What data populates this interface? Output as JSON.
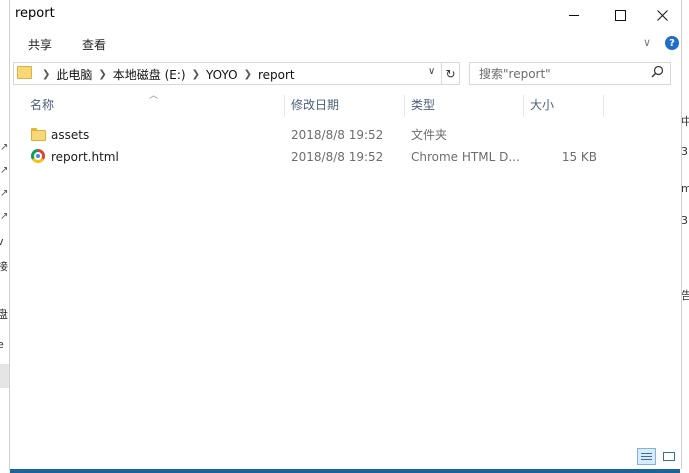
{
  "window": {
    "title": "report",
    "controls": {
      "minimize": "minimize-icon",
      "maximize": "maximize-icon",
      "close": "close-icon"
    }
  },
  "ribbon": {
    "tabs": [
      "共享",
      "查看"
    ],
    "expand_icon": "chevron-down-icon",
    "help_label": "?"
  },
  "address": {
    "breadcrumb": [
      "此电脑",
      "本地磁盘 (E:)",
      "YOYO",
      "report"
    ],
    "dropdown_icon": "chevron-down-icon",
    "refresh_icon": "refresh-icon"
  },
  "search": {
    "placeholder": "搜索\"report\"",
    "icon": "search-icon"
  },
  "columns": {
    "name": "名称",
    "date": "修改日期",
    "type": "类型",
    "size": "大小"
  },
  "files": [
    {
      "name": "assets",
      "date": "2018/8/8 19:52",
      "type": "文件夹",
      "size": "",
      "icon": "folder-icon"
    },
    {
      "name": "report.html",
      "date": "2018/8/8 19:52",
      "type": "Chrome HTML D...",
      "size": "15 KB",
      "icon": "chrome-icon"
    }
  ],
  "view_buttons": {
    "details": "details-view-icon",
    "large": "large-icons-view-icon"
  },
  "background_left": {
    "chars": [
      "v",
      "接",
      "盘",
      "e"
    ]
  },
  "background_right": {
    "chars": [
      "中",
      "3",
      "m",
      "3",
      "告"
    ]
  },
  "colors": {
    "accent": "#1f6fc9",
    "header_text": "#4c607a",
    "folder": "#f8d775",
    "selection": "#d9ebfa"
  }
}
